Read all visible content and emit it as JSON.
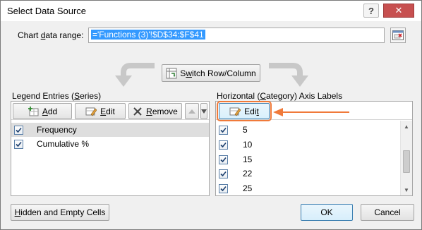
{
  "window": {
    "title": "Select Data Source",
    "help_label": "?",
    "close_label": "✕"
  },
  "range": {
    "label_pre": "Chart ",
    "label_accel": "d",
    "label_post": "ata range:",
    "value": "='Functions (3)'!$D$34:$F$41"
  },
  "switch_button": {
    "label_pre": "S",
    "label_accel": "w",
    "label_post": "itch Row/Column"
  },
  "legend": {
    "title_pre": "Legend Entries (",
    "title_accel": "S",
    "title_post": "eries)",
    "add_accel": "A",
    "add_rest": "dd",
    "edit_accel": "E",
    "edit_rest": "dit",
    "remove_accel": "R",
    "remove_rest": "emove",
    "series": [
      {
        "label": "Frequency",
        "checked": true
      },
      {
        "label": "Cumulative %",
        "checked": true
      }
    ]
  },
  "axis": {
    "title_pre": "Horizontal (",
    "title_accel": "C",
    "title_post": "ategory) Axis Labels",
    "edit_pre": "Edi",
    "edit_accel": "t",
    "categories": [
      {
        "label": "5",
        "checked": true
      },
      {
        "label": "10",
        "checked": true
      },
      {
        "label": "15",
        "checked": true
      },
      {
        "label": "22",
        "checked": true
      },
      {
        "label": "25",
        "checked": true
      }
    ]
  },
  "footer": {
    "hidden_accel": "H",
    "hidden_rest": "idden and Empty Cells",
    "ok_label": "OK",
    "cancel_label": "Cancel"
  },
  "colors": {
    "accent_orange": "#f07a3a",
    "selection_blue": "#3399ff"
  }
}
